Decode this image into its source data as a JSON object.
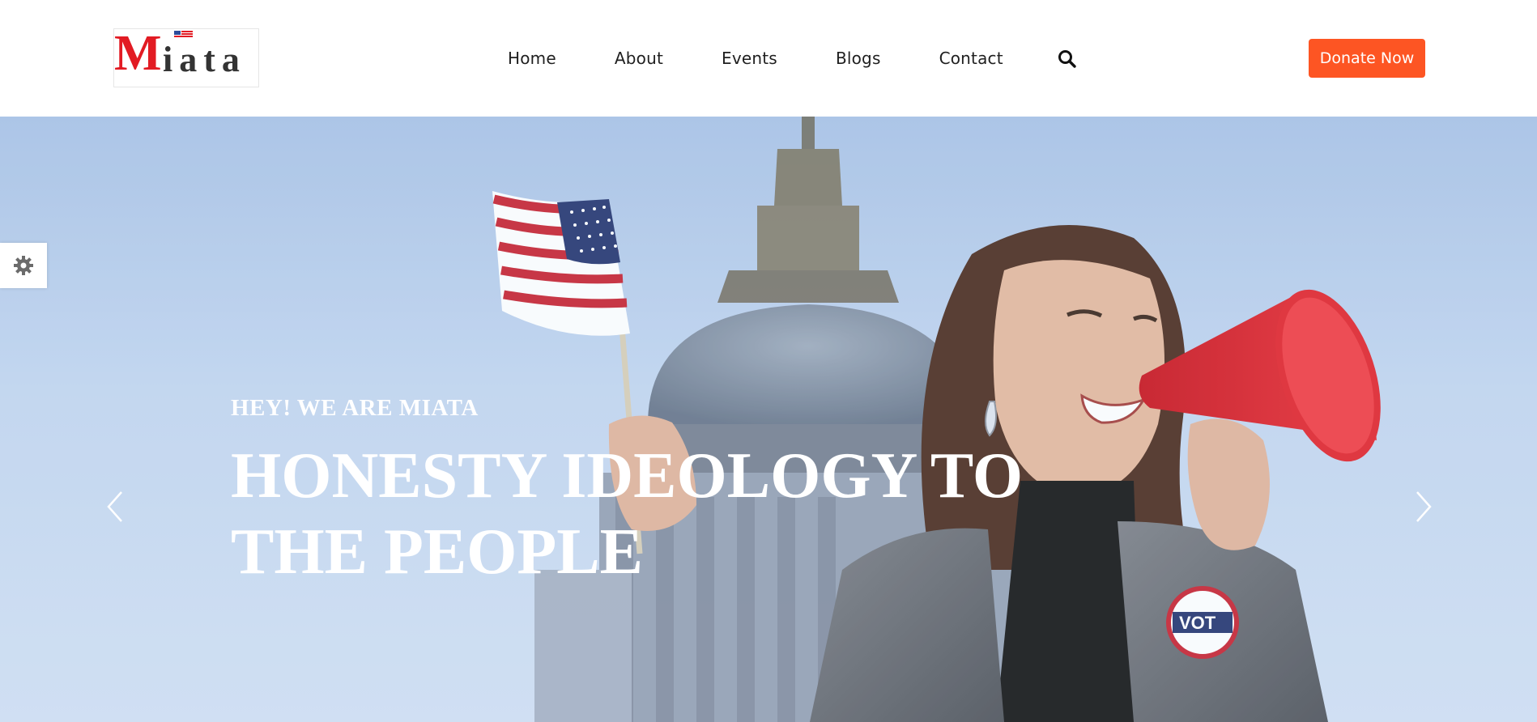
{
  "brand": {
    "logo_text": "Miata",
    "accent_color": "#fd5523",
    "logo_red": "#e21b23"
  },
  "nav": {
    "items": [
      {
        "label": "Home"
      },
      {
        "label": "About"
      },
      {
        "label": "Events"
      },
      {
        "label": "Blogs"
      },
      {
        "label": "Contact"
      }
    ],
    "search_icon": "search-icon"
  },
  "header": {
    "donate_label": "Donate Now"
  },
  "hero": {
    "kicker": "HEY! WE ARE MIATA",
    "headline_line1": "HONESTY IDEOLOGY TO",
    "headline_line2": "THE PEOPLE",
    "prev_icon": "chevron-left-icon",
    "next_icon": "chevron-right-icon"
  },
  "settings": {
    "icon": "gear-icon"
  }
}
